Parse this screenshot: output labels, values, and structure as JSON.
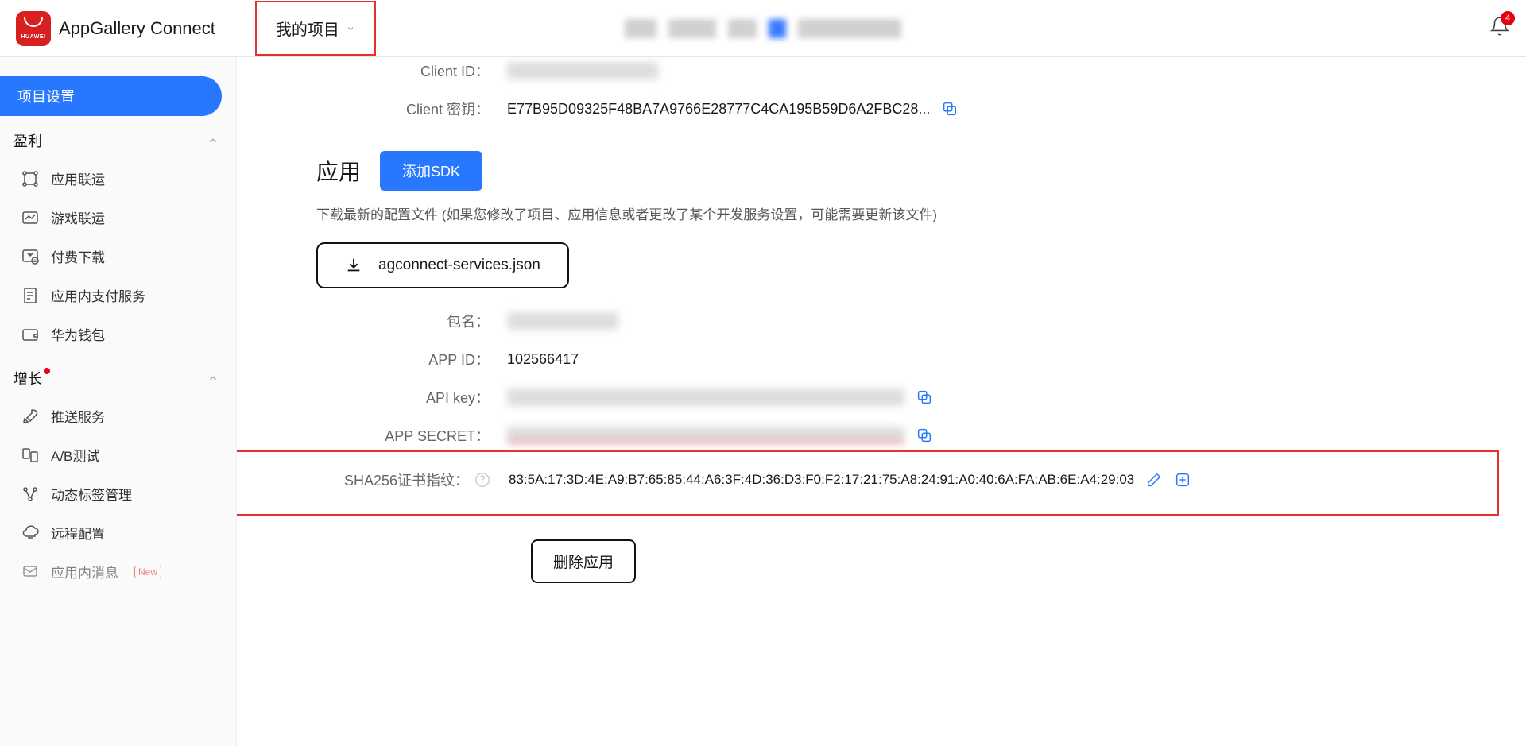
{
  "header": {
    "product_name": "AppGallery Connect",
    "my_project_label": "我的项目",
    "bell_badge": "4"
  },
  "sidebar": {
    "project_settings": "项目设置",
    "profit_group": "盈利",
    "profit_items": [
      {
        "label": "应用联运"
      },
      {
        "label": "游戏联运"
      },
      {
        "label": "付费下载"
      },
      {
        "label": "应用内支付服务"
      },
      {
        "label": "华为钱包"
      }
    ],
    "growth_group": "增长",
    "growth_items": [
      {
        "label": "推送服务"
      },
      {
        "label": "A/B测试"
      },
      {
        "label": "动态标签管理"
      },
      {
        "label": "远程配置"
      },
      {
        "label": "应用内消息",
        "new": "New"
      }
    ]
  },
  "details": {
    "client_id_label": "Client ID：",
    "client_id_value": "（已隐藏）",
    "client_secret_label": "Client 密钥：",
    "client_secret_value": "E77B95D09325F48BA7A9766E28777C4CA195B59D6A2FBC28...",
    "app_section_title": "应用",
    "add_sdk_label": "添加SDK",
    "download_hint": "下载最新的配置文件 (如果您修改了项目、应用信息或者更改了某个开发服务设置，可能需要更新该文件)",
    "download_filename": "agconnect-services.json",
    "package_label": "包名：",
    "app_id_label": "APP ID：",
    "app_id_value": "102566417",
    "api_key_label": "API key：",
    "app_secret_label": "APP SECRET：",
    "sha256_label": "SHA256证书指纹：",
    "sha256_value": "83:5A:17:3D:4E:A9:B7:65:85:44:A6:3F:4D:36:D3:F0:F2:17:21:75:A8:24:91:A0:40:6A:FA:AB:6E:A4:29:03",
    "delete_app_label": "删除应用"
  }
}
